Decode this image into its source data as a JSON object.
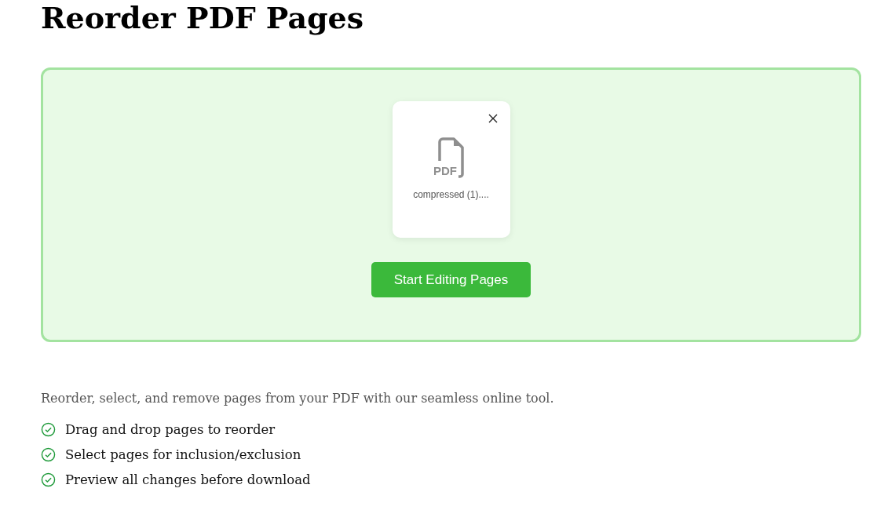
{
  "title": "Reorder PDF Pages",
  "file": {
    "name": "compressed (1)....",
    "icon_label": "PDF"
  },
  "button": "Start Editing Pages",
  "description": "Reorder, select, and remove pages from your PDF with our seamless online tool.",
  "features": [
    "Drag and drop pages to reorder",
    "Select pages for inclusion/exclusion",
    "Preview all changes before download"
  ]
}
